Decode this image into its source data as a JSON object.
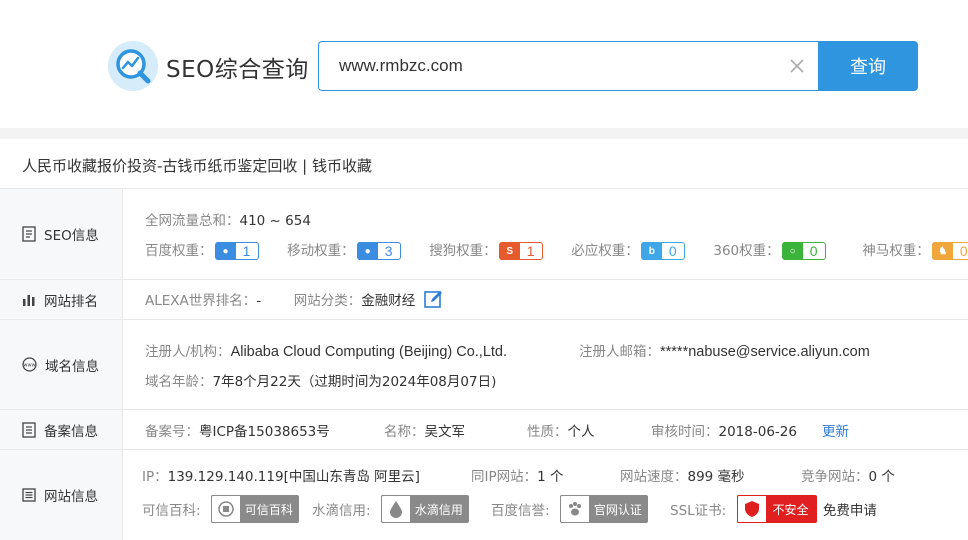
{
  "header": {
    "logo_title": "SEO综合查询",
    "search_value": "www.rmbzc.com",
    "search_button": "查询"
  },
  "site_title": "人民币收藏报价投资-古钱币纸币鉴定回收 | 钱币收藏",
  "seo": {
    "label": "SEO信息",
    "traffic_label": "全网流量总和：",
    "traffic_value": "410 ~ 654",
    "weights": [
      {
        "label": "百度权重：",
        "value": "1",
        "icon": "baidu-paw-icon",
        "color": "#3a8de0"
      },
      {
        "label": "移动权重：",
        "value": "3",
        "icon": "mobile-paw-icon",
        "color": "#3a8de0"
      },
      {
        "label": "搜狗权重：",
        "value": "1",
        "icon": "sogou-icon",
        "color": "#e55b2d"
      },
      {
        "label": "必应权重：",
        "value": "0",
        "icon": "bing-icon",
        "color": "#3fa6e8"
      },
      {
        "label": "360权重：",
        "value": "0",
        "icon": "360-icon",
        "color": "#3cb43c"
      },
      {
        "label": "神马权重：",
        "value": "0",
        "icon": "shenma-icon",
        "color": "#f0a63a"
      }
    ]
  },
  "ranking": {
    "label": "网站排名",
    "alexa_label": "ALEXA世界排名：",
    "alexa_value": "-",
    "category_label": "网站分类：",
    "category_value": "金融财经"
  },
  "domain": {
    "label": "域名信息",
    "registrant_label": "注册人/机构：",
    "registrant_value": "Alibaba Cloud Computing (Beijing) Co.,Ltd.",
    "email_label": "注册人邮箱：",
    "email_value": "*****nabuse@service.aliyun.com",
    "age_label": "域名年龄：",
    "age_value": "7年8个月22天（过期时间为2024年08月07日)"
  },
  "icp": {
    "label": "备案信息",
    "number_label": "备案号：",
    "number_value": "粤ICP备15038653号",
    "name_label": "名称：",
    "name_value": "吴文军",
    "nature_label": "性质：",
    "nature_value": "个人",
    "audit_label": "审核时间：",
    "audit_value": "2018-06-26",
    "update_link": "更新"
  },
  "siteinfo": {
    "label": "网站信息",
    "ip_label": "IP：",
    "ip_value": "139.129.140.119[中国山东青岛 阿里云]",
    "sameip_label": "同IP网站：",
    "sameip_value": "1 个",
    "speed_label": "网站速度：",
    "speed_value": "899 毫秒",
    "compete_label": "竞争网站：",
    "compete_value": "0 个",
    "kexin_label": "可信百科:",
    "kexin_badge": "可信百科",
    "shuidi_label": "水滴信用:",
    "shuidi_badge": "水滴信用",
    "baidu_label": "百度信誉:",
    "baidu_badge": "官网认证",
    "ssl_label": "SSL证书:",
    "ssl_badge": "不安全",
    "ssl_apply": "免费申请"
  }
}
